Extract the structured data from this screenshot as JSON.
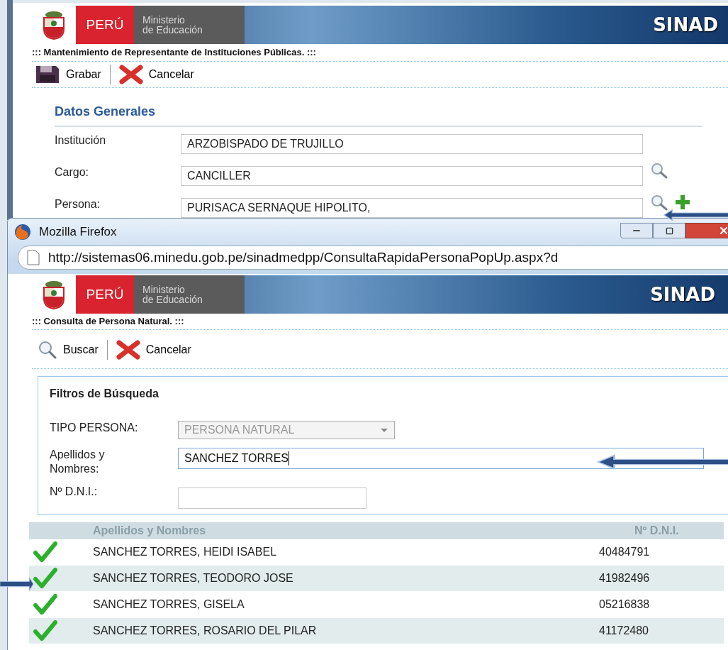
{
  "background_page": {
    "header": {
      "country": "PERÚ",
      "ministry_line1": "Ministerio",
      "ministry_line2": "de Educación",
      "system": "SINAD"
    },
    "title": "::: Mantenimiento de Representante de Instituciones Públicas. :::",
    "toolbar": [
      {
        "kind": "save",
        "label": "Grabar"
      },
      {
        "kind": "cancel",
        "label": "Cancelar"
      }
    ],
    "section_title": "Datos Generales",
    "fields": [
      {
        "label": "Institución",
        "value": "ARZOBISPADO DE TRUJILLO",
        "search": false,
        "add": false
      },
      {
        "label": "Cargo:",
        "value": "CANCILLER",
        "search": true,
        "add": false
      },
      {
        "label": "Persona:",
        "value": "PURISACA SERNAQUE HIPOLITO,",
        "search": true,
        "add": true
      }
    ]
  },
  "popup": {
    "window_title": "Mozilla Firefox",
    "url": "http://sistemas06.minedu.gob.pe/sinadmedpp/ConsultaRapidaPersonaPopUp.aspx?d",
    "header": {
      "country": "PERÚ",
      "ministry_line1": "Ministerio",
      "ministry_line2": "de Educación",
      "system": "SINAD"
    },
    "title": "::: Consulta de Persona Natural. :::",
    "toolbar": [
      {
        "kind": "search",
        "label": "Buscar"
      },
      {
        "kind": "cancel",
        "label": "Cancelar"
      }
    ],
    "filters": {
      "title": "Filtros de Búsqueda",
      "fields": [
        {
          "kind": "select",
          "label": "TIPO PERSONA:",
          "value": "PERSONA NATURAL",
          "disabled": true
        },
        {
          "kind": "text",
          "label": "Apellidos y Nombres:",
          "value": "SANCHEZ TORRES",
          "focused": true
        },
        {
          "kind": "text",
          "label": "Nº D.N.I.:",
          "focused": false
        }
      ]
    },
    "results": {
      "columns": [
        "Apellidos y Nombres",
        "Nº D.N.I."
      ],
      "rows": [
        {
          "name": "SANCHEZ TORRES, HEIDI ISABEL",
          "dni": "40484791"
        },
        {
          "name": "SANCHEZ TORRES, TEODORO JOSE",
          "dni": "41982496"
        },
        {
          "name": "SANCHEZ TORRES, GISELA",
          "dni": "05216838"
        },
        {
          "name": "SANCHEZ TORRES, ROSARIO DEL PILAR",
          "dni": "41172480"
        }
      ]
    }
  }
}
